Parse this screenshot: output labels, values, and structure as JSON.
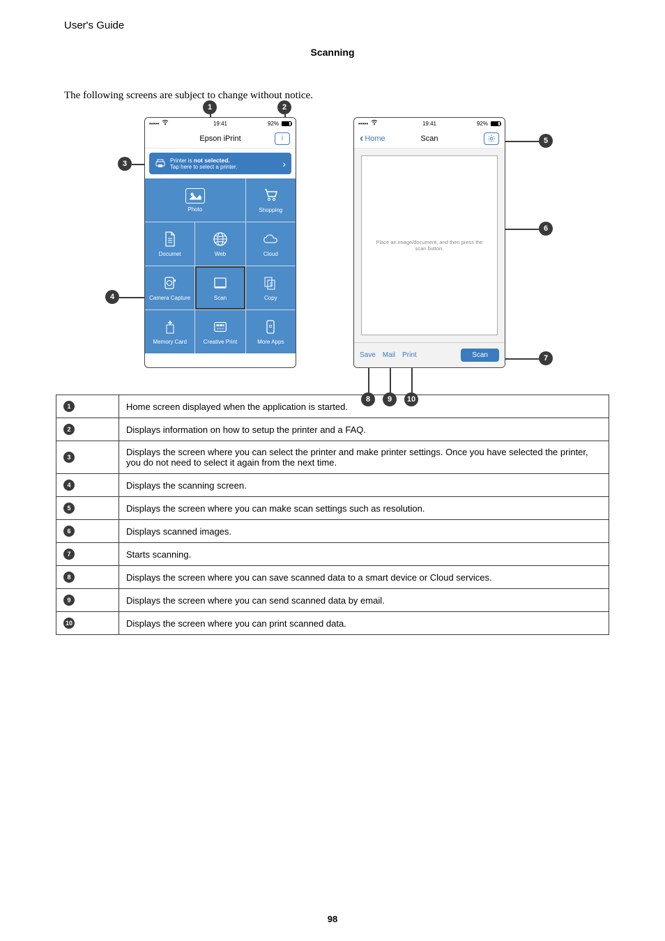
{
  "header": {
    "guide_title": "User's Guide",
    "section": "Scanning"
  },
  "intro": "The following screens are subject to change without notice.",
  "statusbar": {
    "signal": "•••••",
    "time": "19:41",
    "battery": "92%"
  },
  "home_screen": {
    "title": "Epson iPrint",
    "info_icon_label": "i",
    "printer_banner_line1": "Printer is not selected.",
    "printer_banner_line2": "Tap here to select a printer.",
    "tiles": {
      "photo": "Photo",
      "shopping": "Shopping",
      "document": "Documet",
      "web": "Web",
      "cloud": "Cloud",
      "camera": "Camera Capture",
      "scan": "Scan",
      "copy": "Copy",
      "memory": "Memory Card",
      "creative": "Creative Print",
      "more": "More Apps"
    }
  },
  "scan_screen": {
    "back": "Home",
    "title": "Scan",
    "placeholder": "Place an image/document, and then press the scan button.",
    "save": "Save",
    "mail": "Mail",
    "print": "Print",
    "scan_btn": "Scan"
  },
  "callouts": {
    "1": "Home screen displayed when the application is started.",
    "2": "Displays information on how to setup the printer and a FAQ.",
    "3": "Displays the screen where you can select the printer and make printer settings. Once you have selected the printer, you do not need to select it again from the next time.",
    "4": "Displays the scanning screen.",
    "5": "Displays the screen where you can make scan settings such as resolution.",
    "6": "Displays scanned images.",
    "7": "Starts scanning.",
    "8": "Displays the screen where you can save scanned data to a smart device or Cloud services.",
    "9": "Displays the screen where you can send scanned data by email.",
    "10": "Displays the screen where you can print scanned data."
  },
  "page_number": "98"
}
